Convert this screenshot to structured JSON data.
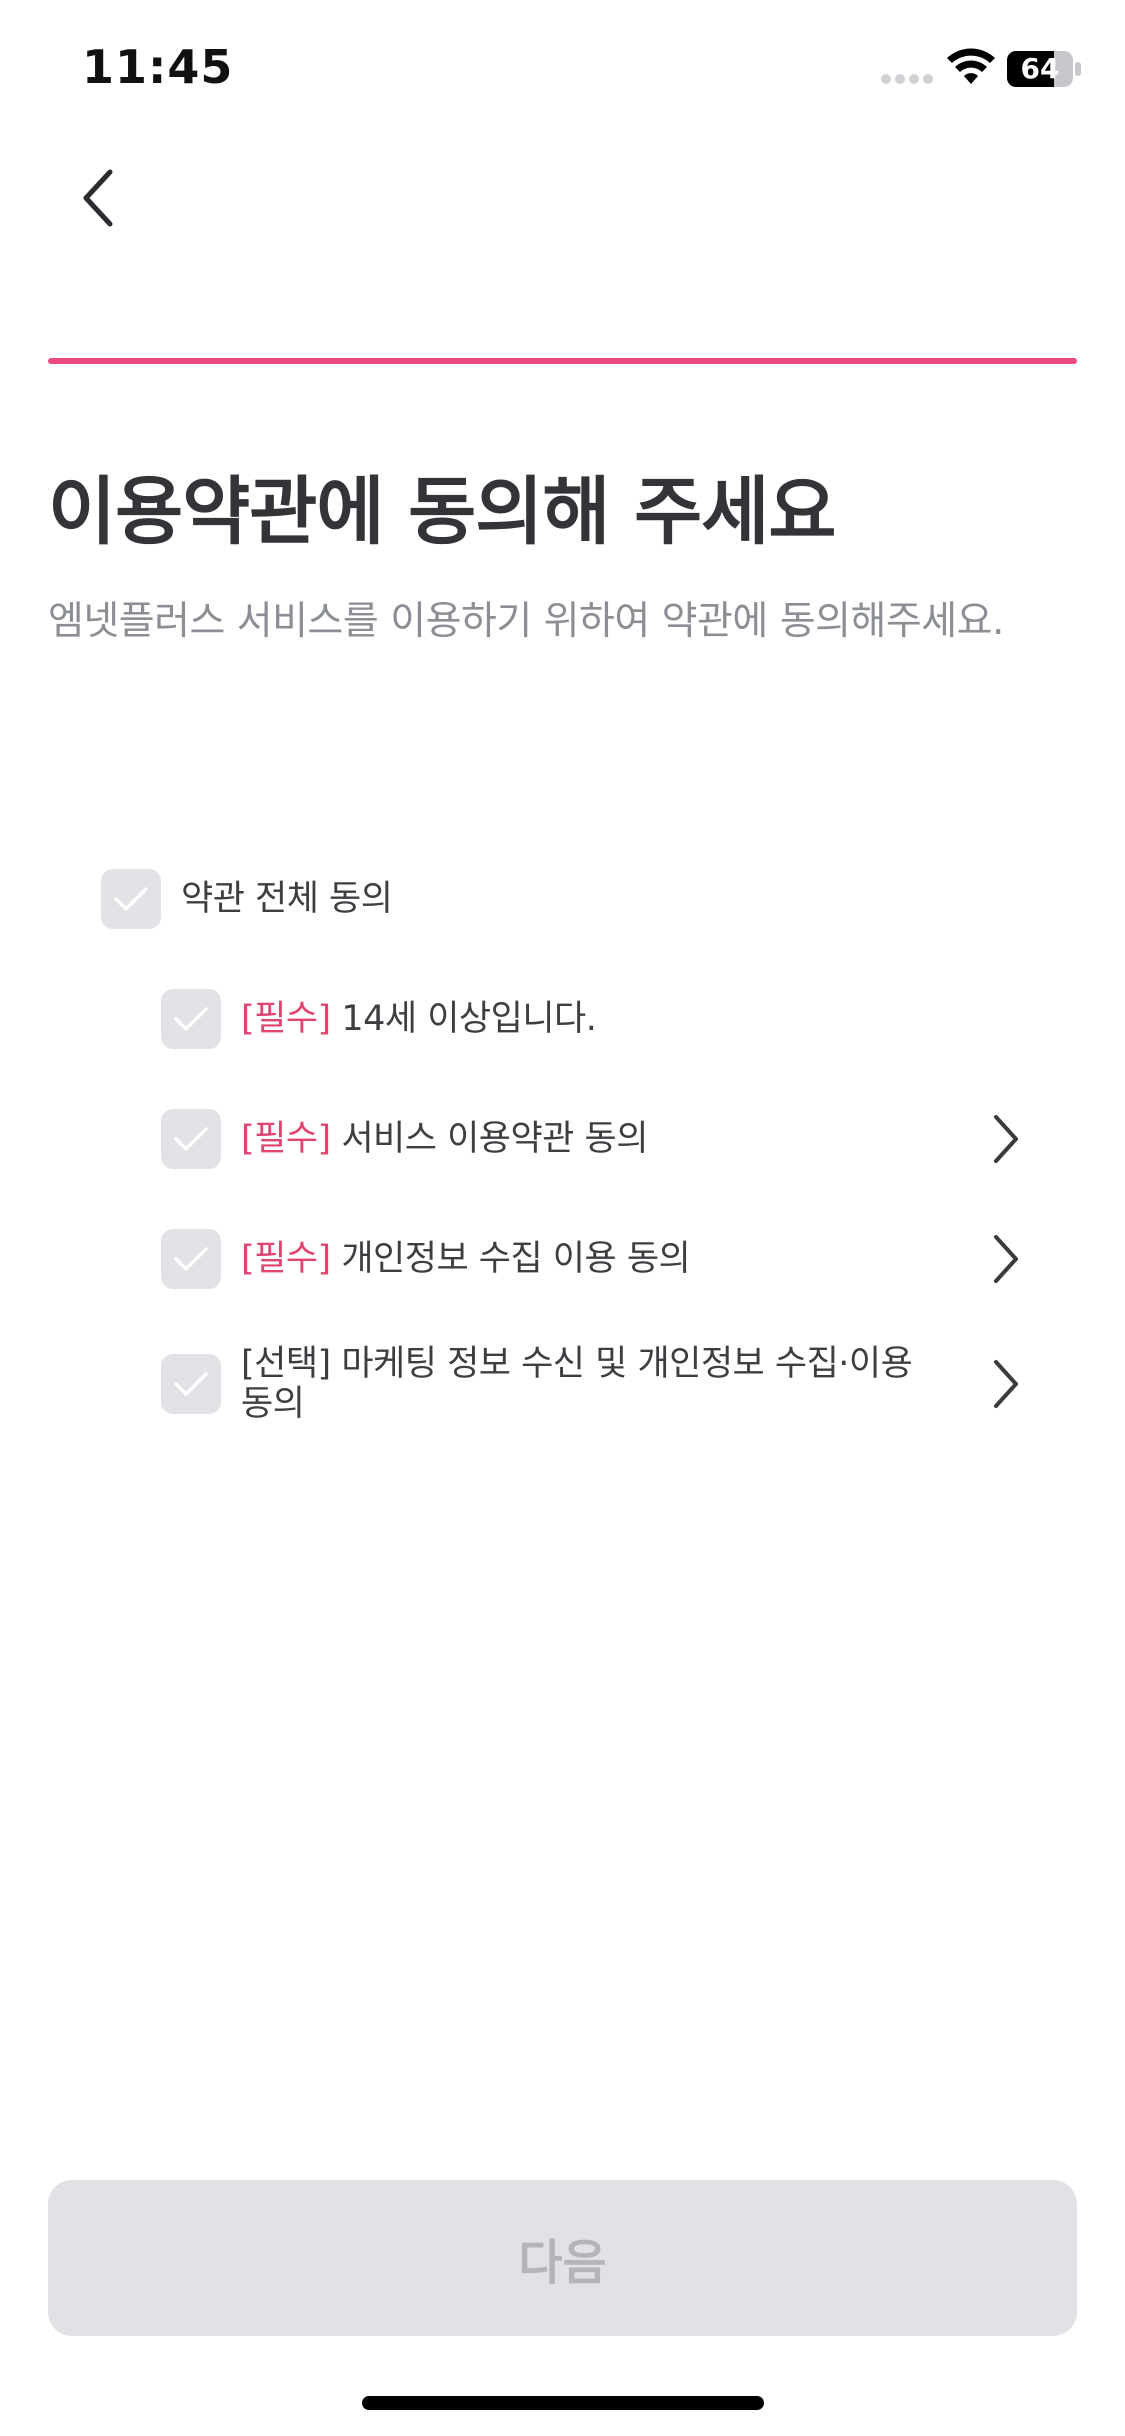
{
  "status_bar": {
    "time": "11:45",
    "battery": "64"
  },
  "progress": {
    "fraction": 1.0,
    "color": "#e94a7f"
  },
  "header": {
    "title": "이용약관에 동의해 주세요",
    "subtitle": "엠넷플러스 서비스를 이용하기 위하여 약관에 동의해주세요."
  },
  "agreements": {
    "all": {
      "label": "약관 전체 동의"
    },
    "items": [
      {
        "tag": "[필수]",
        "text": "14세 이상입니다.",
        "has_detail": false
      },
      {
        "tag": "[필수]",
        "text": "서비스 이용약관 동의",
        "has_detail": true
      },
      {
        "tag": "[필수]",
        "text": "개인정보 수집 이용 동의",
        "has_detail": true
      },
      {
        "tag": "[선택]",
        "text": "마케팅 정보 수신 및 개인정보 수집·이용 동의",
        "has_detail": true
      }
    ]
  },
  "footer": {
    "next_label": "다음"
  },
  "icons": {
    "back": "chevron-left-icon",
    "check": "check-icon",
    "detail": "chevron-right-icon"
  },
  "colors": {
    "accent": "#e94a7f",
    "required_tag": "#e1456f",
    "checkbox_bg": "#e1e2e5",
    "button_disabled_bg": "#e1e2e5",
    "button_disabled_text": "#b3b5b9"
  }
}
